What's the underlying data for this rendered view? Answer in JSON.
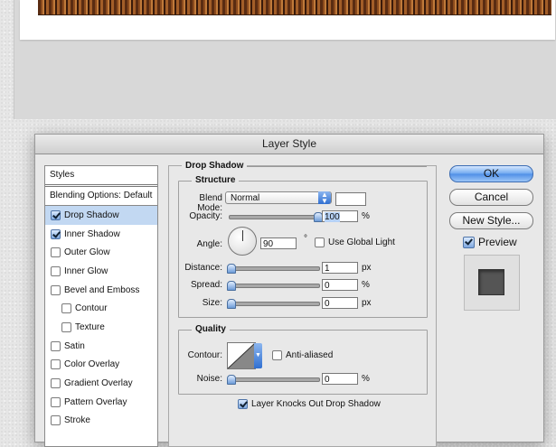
{
  "window": {
    "title": "Layer Style"
  },
  "styles_panel": {
    "header": "Styles",
    "blending_options": "Blending Options: Default",
    "items": [
      {
        "label": "Drop Shadow",
        "checked": true,
        "selected": true,
        "indent": false
      },
      {
        "label": "Inner Shadow",
        "checked": true,
        "selected": false,
        "indent": false
      },
      {
        "label": "Outer Glow",
        "checked": false,
        "selected": false,
        "indent": false
      },
      {
        "label": "Inner Glow",
        "checked": false,
        "selected": false,
        "indent": false
      },
      {
        "label": "Bevel and Emboss",
        "checked": false,
        "selected": false,
        "indent": false
      },
      {
        "label": "Contour",
        "checked": false,
        "selected": false,
        "indent": true
      },
      {
        "label": "Texture",
        "checked": false,
        "selected": false,
        "indent": true
      },
      {
        "label": "Satin",
        "checked": false,
        "selected": false,
        "indent": false
      },
      {
        "label": "Color Overlay",
        "checked": false,
        "selected": false,
        "indent": false
      },
      {
        "label": "Gradient Overlay",
        "checked": false,
        "selected": false,
        "indent": false
      },
      {
        "label": "Pattern Overlay",
        "checked": false,
        "selected": false,
        "indent": false
      },
      {
        "label": "Stroke",
        "checked": false,
        "selected": false,
        "indent": false
      }
    ]
  },
  "drop_shadow": {
    "section_title": "Drop Shadow",
    "structure": {
      "title": "Structure",
      "blend_mode_label": "Blend Mode:",
      "blend_mode_value": "Normal",
      "shadow_color": "#ffffff",
      "opacity_label": "Opacity:",
      "opacity_value": "100",
      "opacity_unit": "%",
      "angle_label": "Angle:",
      "angle_value": "90",
      "angle_unit": "°",
      "use_global_light_label": "Use Global Light",
      "use_global_light_checked": false,
      "distance_label": "Distance:",
      "distance_value": "1",
      "distance_unit": "px",
      "spread_label": "Spread:",
      "spread_value": "0",
      "spread_unit": "%",
      "size_label": "Size:",
      "size_value": "0",
      "size_unit": "px"
    },
    "quality": {
      "title": "Quality",
      "contour_label": "Contour:",
      "anti_aliased_label": "Anti-aliased",
      "anti_aliased_checked": false,
      "noise_label": "Noise:",
      "noise_value": "0",
      "noise_unit": "%"
    },
    "knockout_label": "Layer Knocks Out Drop Shadow",
    "knockout_checked": true
  },
  "buttons": {
    "ok": "OK",
    "cancel": "Cancel",
    "new_style": "New Style..."
  },
  "preview": {
    "label": "Preview",
    "checked": true
  }
}
